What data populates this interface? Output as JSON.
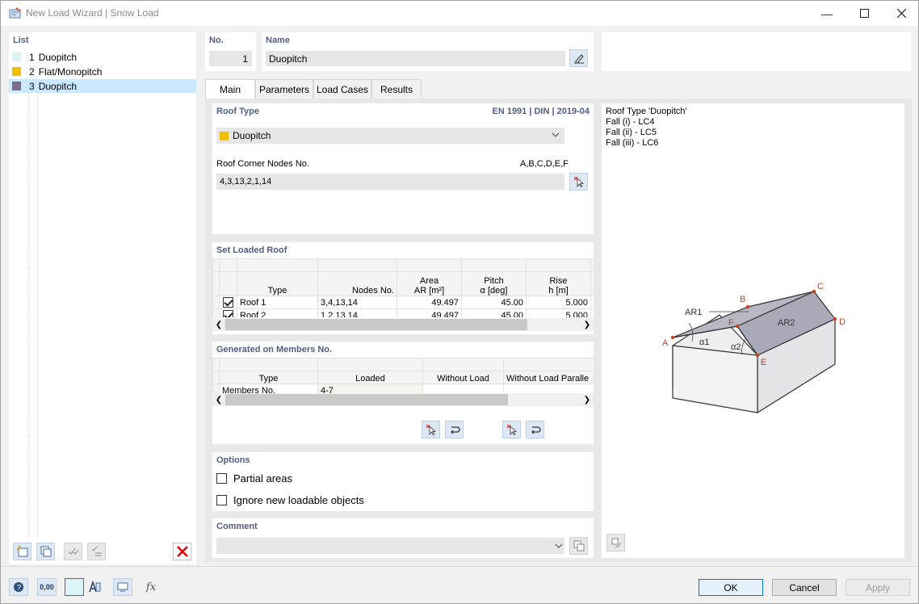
{
  "window": {
    "title": "New Load Wizard | Snow Load"
  },
  "list": {
    "header": "List",
    "items": [
      {
        "no": "1",
        "name": "Duopitch",
        "color": "#d8f4f4"
      },
      {
        "no": "2",
        "name": "Flat/Monopitch",
        "color": "#f0c000"
      },
      {
        "no": "3",
        "name": "Duopitch",
        "color": "#7b6b88"
      }
    ]
  },
  "header": {
    "no_label": "No.",
    "no_value": "1",
    "name_label": "Name",
    "name_value": "Duopitch"
  },
  "tabs": [
    {
      "label": "Main",
      "active": true
    },
    {
      "label": "Parameters",
      "active": false
    },
    {
      "label": "Load Cases",
      "active": false
    },
    {
      "label": "Results",
      "active": false
    }
  ],
  "roof_type": {
    "header": "Roof Type",
    "standard": "EN 1991 | DIN | 2019-04",
    "selected": "Duopitch",
    "selected_color": "#f0c000",
    "corner_label": "Roof Corner Nodes No.",
    "corner_hint": "A,B,C,D,E,F",
    "corner_value": "4,3,13,2,1,14"
  },
  "loaded_roof": {
    "header": "Set Loaded Roof",
    "columns": [
      {
        "top": "",
        "bottom": "Type"
      },
      {
        "top": "",
        "bottom": "Nodes No."
      },
      {
        "top": "Area",
        "bottom": "AR [m²]"
      },
      {
        "top": "Pitch",
        "bottom": "α [deg]"
      },
      {
        "top": "Rise",
        "bottom": "h [m]"
      }
    ],
    "rows": [
      {
        "checked": true,
        "type": "Roof 1",
        "nodes": "3,4,13,14",
        "area": "49.497",
        "pitch": "45.00",
        "rise": "5.000"
      },
      {
        "checked": true,
        "type": "Roof 2",
        "nodes": "1,2,13,14",
        "area": "49.497",
        "pitch": "45.00",
        "rise": "5.000"
      }
    ]
  },
  "members": {
    "header": "Generated on Members No.",
    "columns": [
      "Type",
      "Loaded",
      "Without Load",
      "Without Load Paralle"
    ],
    "rows": [
      {
        "type": "Members No.",
        "loaded": "4-7",
        "without": "",
        "parallel": ""
      }
    ]
  },
  "options": {
    "header": "Options",
    "items": [
      {
        "label": "Partial areas",
        "checked": false
      },
      {
        "label": "Ignore new loadable objects",
        "checked": false
      }
    ]
  },
  "comment": {
    "header": "Comment",
    "value": ""
  },
  "info": {
    "lines": [
      "Roof Type 'Duopitch'",
      "Fall (i) - LC4",
      "Fall (ii) - LC5",
      "Fall (iii) - LC6"
    ]
  },
  "diagram": {
    "labels": {
      "a": "A",
      "b": "B",
      "c": "C",
      "d": "D",
      "e": "E",
      "f": "F",
      "ar1": "AR1",
      "ar2": "AR2",
      "alpha1": "α1",
      "alpha2": "α2"
    },
    "point_color": "#c8401e"
  },
  "footer": {
    "ok": "OK",
    "cancel": "Cancel",
    "apply": "Apply",
    "units": "0,00"
  }
}
